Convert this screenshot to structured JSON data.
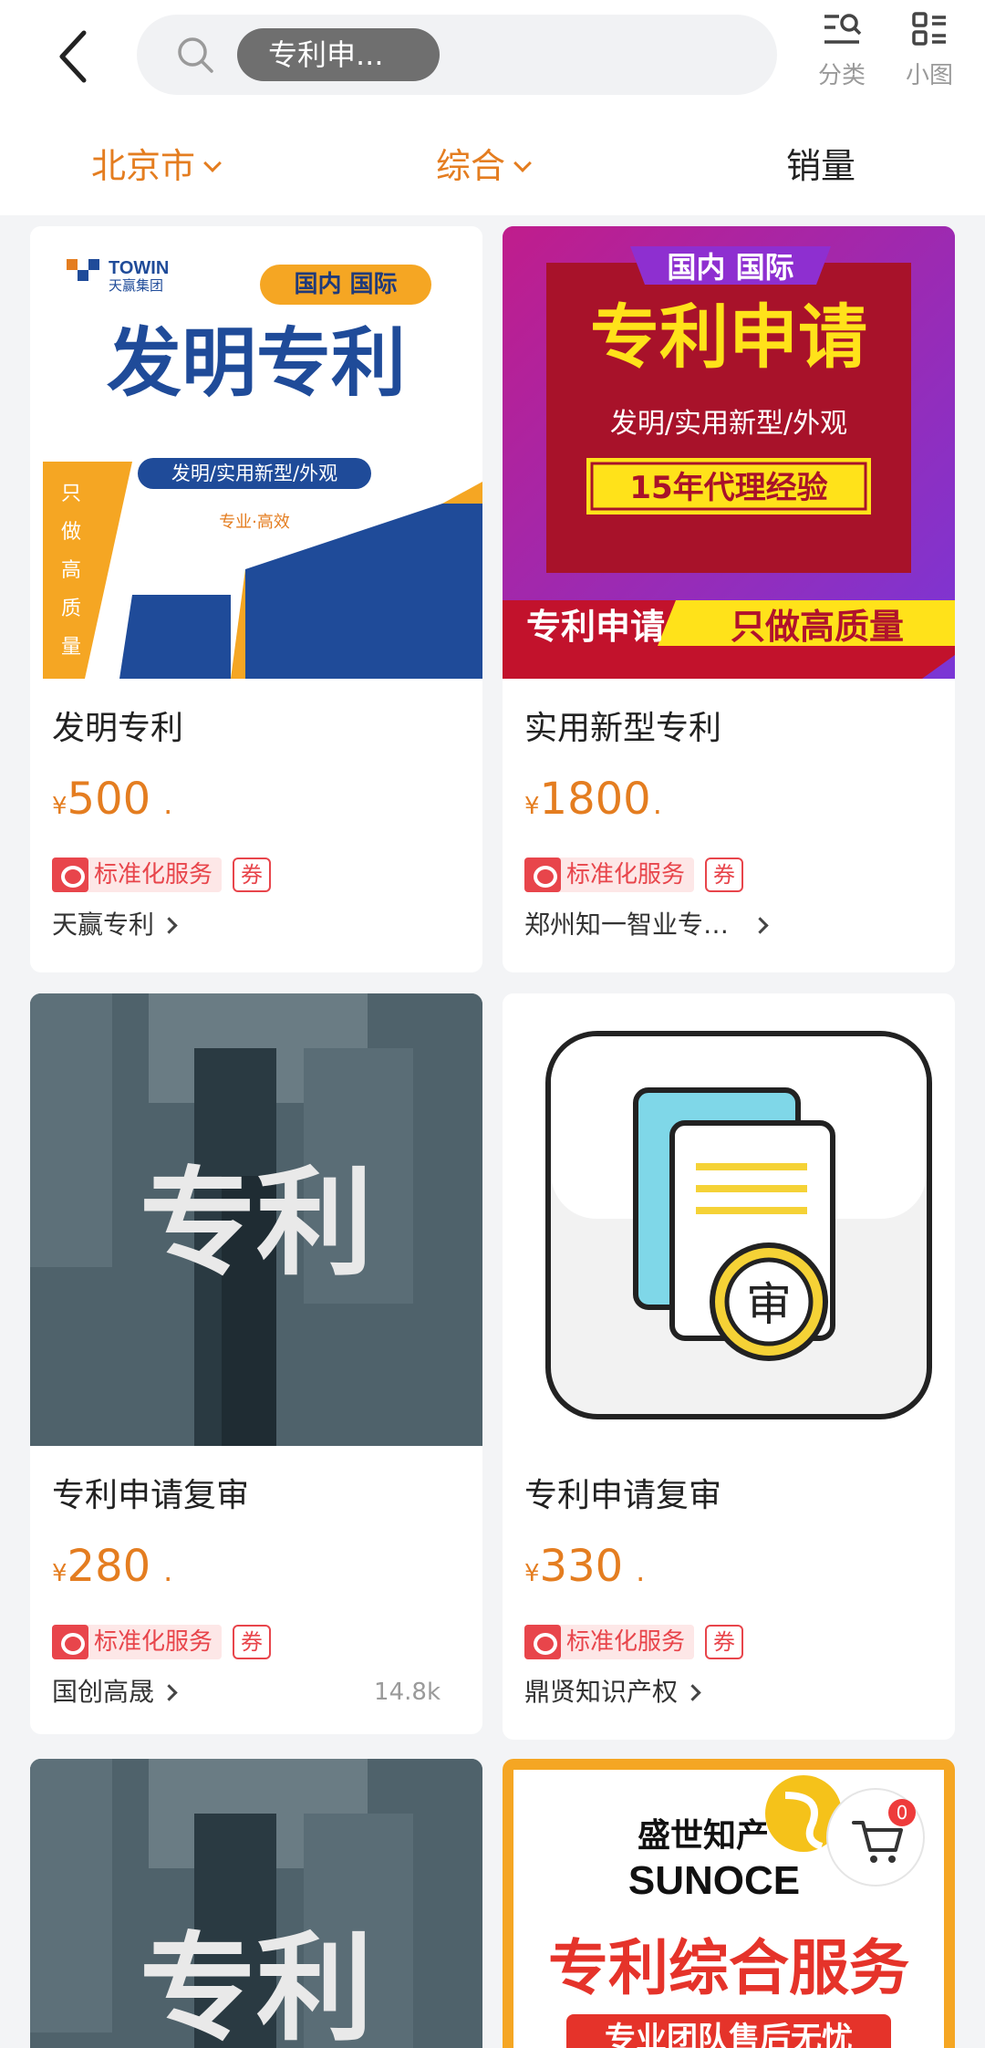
{
  "search": {
    "query_chip": "专利申..."
  },
  "top_actions": [
    {
      "label": "分类",
      "icon": "category-search-icon"
    },
    {
      "label": "小图",
      "icon": "grid-view-icon"
    }
  ],
  "filters": {
    "city": "北京市",
    "sort": "综合",
    "sales": "销量"
  },
  "colors": {
    "accent": "#e47d20",
    "badge_red": "#e8454b"
  },
  "products": [
    {
      "title": "发明专利",
      "currency": "¥",
      "price": "500",
      "price_suffix": ".",
      "badge": "标准化服务",
      "coupon": "券",
      "shop": "天赢专利",
      "image_text": {
        "brand": "TOWIN",
        "brand_cn": "天赢集团",
        "tag": "国内 国际",
        "headline": "发明专利",
        "sub": "发明/实用新型/外观",
        "slogan": "专业·高效",
        "side": "只做高质量"
      }
    },
    {
      "title": "实用新型专利",
      "currency": "¥",
      "price": "1800",
      "price_suffix": ".",
      "badge": "标准化服务",
      "coupon": "券",
      "shop": "郑州知一智业专…",
      "image_text": {
        "tag": "国内 国际",
        "headline": "专利申请",
        "sub": "发明/实用新型/外观",
        "slogan": "15年代理经验",
        "left_band": "专利申请",
        "right_band": "只做高质量"
      }
    },
    {
      "title": "专利申请复审",
      "currency": "¥",
      "price": "280",
      "price_suffix": ".",
      "badge": "标准化服务",
      "coupon": "券",
      "shop": "国创高晟",
      "sold": "14.8k",
      "image_text": {
        "headline": "专利"
      }
    },
    {
      "title": "专利申请复审",
      "currency": "¥",
      "price": "330",
      "price_suffix": ".",
      "badge": "标准化服务",
      "coupon": "券",
      "shop": "鼎贤知识产权",
      "image_text": {
        "seal": "审"
      }
    },
    {
      "image_text": {
        "headline": "专利"
      }
    },
    {
      "image_text": {
        "brand_cn": "盛世知产",
        "brand": "SUNOCE",
        "headline": "专利综合服务",
        "sub": "专业团队售后无忧"
      }
    }
  ],
  "cart": {
    "count": "0"
  }
}
